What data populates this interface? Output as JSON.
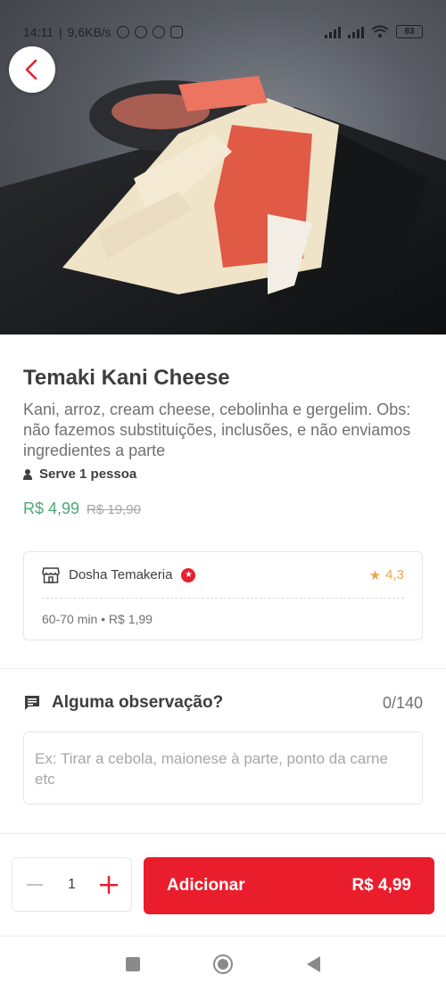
{
  "status_bar": {
    "time": "14:11",
    "net_speed": "9,6KB/s",
    "battery": "83"
  },
  "product": {
    "name": "Temaki Kani Cheese",
    "description": "Kani, arroz, cream cheese, cebolinha e gergelim. Obs: não fazemos substituições, inclusões, e não enviamos ingredientes a parte",
    "serves": "Serve 1 pessoa",
    "price": "R$ 4,99",
    "original_price": "R$ 19,90"
  },
  "store": {
    "name": "Dosha Temakeria",
    "rating": "4,3",
    "delivery_info": "60-70 min • R$ 1,99"
  },
  "observation": {
    "label": "Alguma observação?",
    "counter": "0/140",
    "placeholder": "Ex: Tirar a cebola, maionese à parte, ponto da carne etc"
  },
  "cart": {
    "quantity": "1",
    "add_label": "Adicionar",
    "add_price": "R$ 4,99"
  },
  "colors": {
    "brand_red": "#ea1d2c",
    "price_green": "#50a773",
    "rating_gold": "#e7a74e"
  },
  "icons": [
    "chevron-left-icon",
    "user-icon",
    "store-icon",
    "super-star-icon",
    "star-icon",
    "comment-icon",
    "minus-icon",
    "plus-icon"
  ]
}
